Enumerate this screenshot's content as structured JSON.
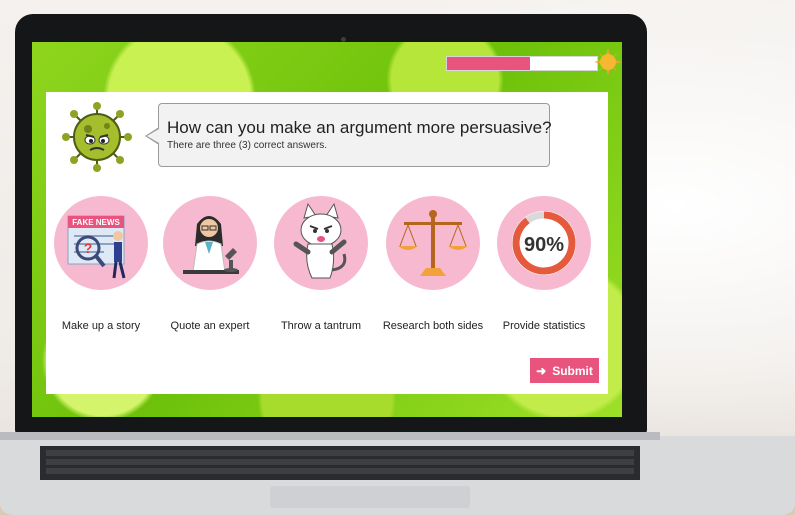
{
  "quiz": {
    "question": "How can you make an argument more persuasive?",
    "hint": "There are three (3) correct answers.",
    "progress": 0.55,
    "options": [
      {
        "label": "Make up a story",
        "icon": "fake-news-icon",
        "badge": "FAKE NEWS"
      },
      {
        "label": "Quote an expert",
        "icon": "scientist-icon"
      },
      {
        "label": "Throw a tantrum",
        "icon": "angry-cat-icon"
      },
      {
        "label": "Research both sides",
        "icon": "balance-scale-icon"
      },
      {
        "label": "Provide statistics",
        "icon": "percentage-gauge-icon",
        "value": "90%"
      }
    ],
    "submit_label": "Submit"
  },
  "colors": {
    "accent": "#e9547f",
    "option_bg": "#f7b9cf",
    "screen_green": "#7fcc14"
  }
}
